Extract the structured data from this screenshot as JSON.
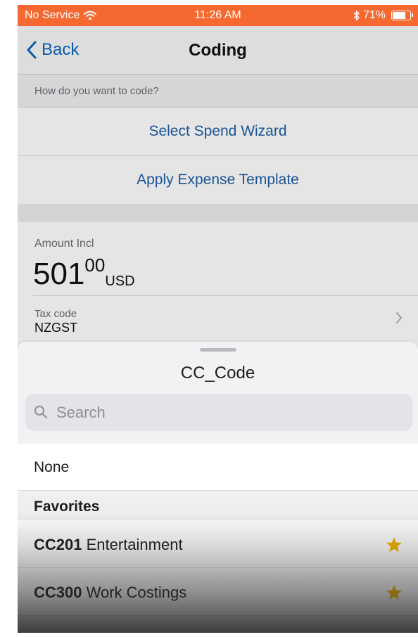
{
  "status_bar": {
    "carrier": "No Service",
    "time": "11:26 AM",
    "battery": "71%",
    "battery_level": 0.71,
    "background_color": "#f5682f",
    "icons": [
      "wifi-icon",
      "bluetooth-icon",
      "battery-icon"
    ]
  },
  "nav": {
    "back_label": "Back",
    "title": "Coding",
    "accent_color": "#0a66c2"
  },
  "coding_options": {
    "prompt": "How do you want to code?",
    "select_spend_wizard": "Select Spend Wizard",
    "apply_expense_template": "Apply Expense Template"
  },
  "amount": {
    "label": "Amount Incl",
    "integer": "501",
    "decimal": "00",
    "currency": "USD"
  },
  "tax": {
    "label": "Tax code",
    "value": "NZGST"
  },
  "sheet": {
    "title": "CC_Code",
    "search_placeholder": "Search",
    "none_option": "None",
    "favorites_header": "Favorites",
    "favorites": [
      {
        "code": "CC201",
        "name": "Entertainment",
        "starred": true
      },
      {
        "code": "CC300",
        "name": "Work Costings",
        "starred": true
      }
    ],
    "star_color": "#f5b400"
  }
}
